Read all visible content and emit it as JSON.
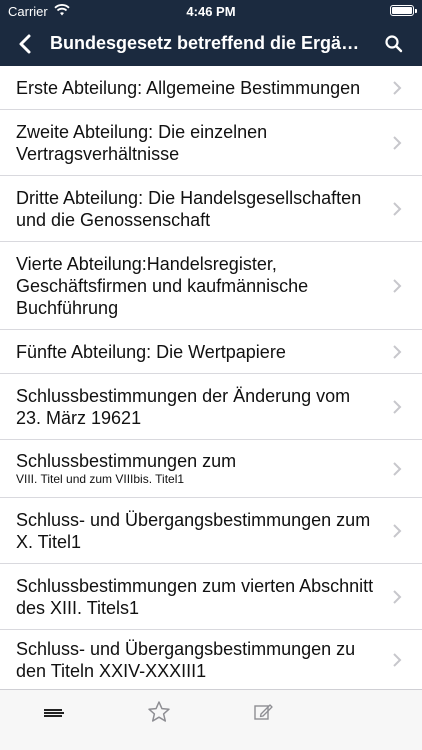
{
  "status_bar": {
    "carrier": "Carrier",
    "time": "4:46 PM"
  },
  "nav": {
    "title": "Bundesgesetz betreffend die Ergänz..."
  },
  "items": [
    {
      "label": "Erste Abteilung: Allgemeine Bestimmungen",
      "sub": ""
    },
    {
      "label": "Zweite Abteilung: Die einzelnen Vertragsverhältnisse",
      "sub": ""
    },
    {
      "label": "Dritte Abteilung: Die Handelsgesellschaften und die Genossenschaft",
      "sub": ""
    },
    {
      "label": "Vierte Abteilung:Handelsregister, Geschäftsfirmen und kaufmännische Buchführung",
      "sub": ""
    },
    {
      "label": "Fünfte Abteilung: Die Wertpapiere",
      "sub": ""
    },
    {
      "label": "Schlussbestimmungen der Änderung vom 23. März 19621",
      "sub": ""
    },
    {
      "label": "Schlussbestimmungen zum",
      "sub": "VIII. Titel und zum VIIIbis. Titel1"
    },
    {
      "label": "Schluss- und Übergangsbestimmungen zum X. Titel1",
      "sub": ""
    },
    {
      "label": "Schlussbestimmungen zum vierten Abschnitt des XIII. Titels1",
      "sub": ""
    },
    {
      "label": "Schluss- und Übergangsbestimmungen zu den Titeln XXIV-XXXIII1",
      "sub": ""
    }
  ],
  "icons": {
    "back": "chevron-left-icon",
    "search": "search-icon",
    "row_chevron": "chevron-right-icon",
    "tabs": [
      "list-icon",
      "star-icon",
      "edit-icon"
    ]
  },
  "colors": {
    "nav_bg": "#1b2a3f",
    "separator": "#d9d9de",
    "chevron": "#c7c7cc",
    "tab_icon": "#8e8e93"
  }
}
